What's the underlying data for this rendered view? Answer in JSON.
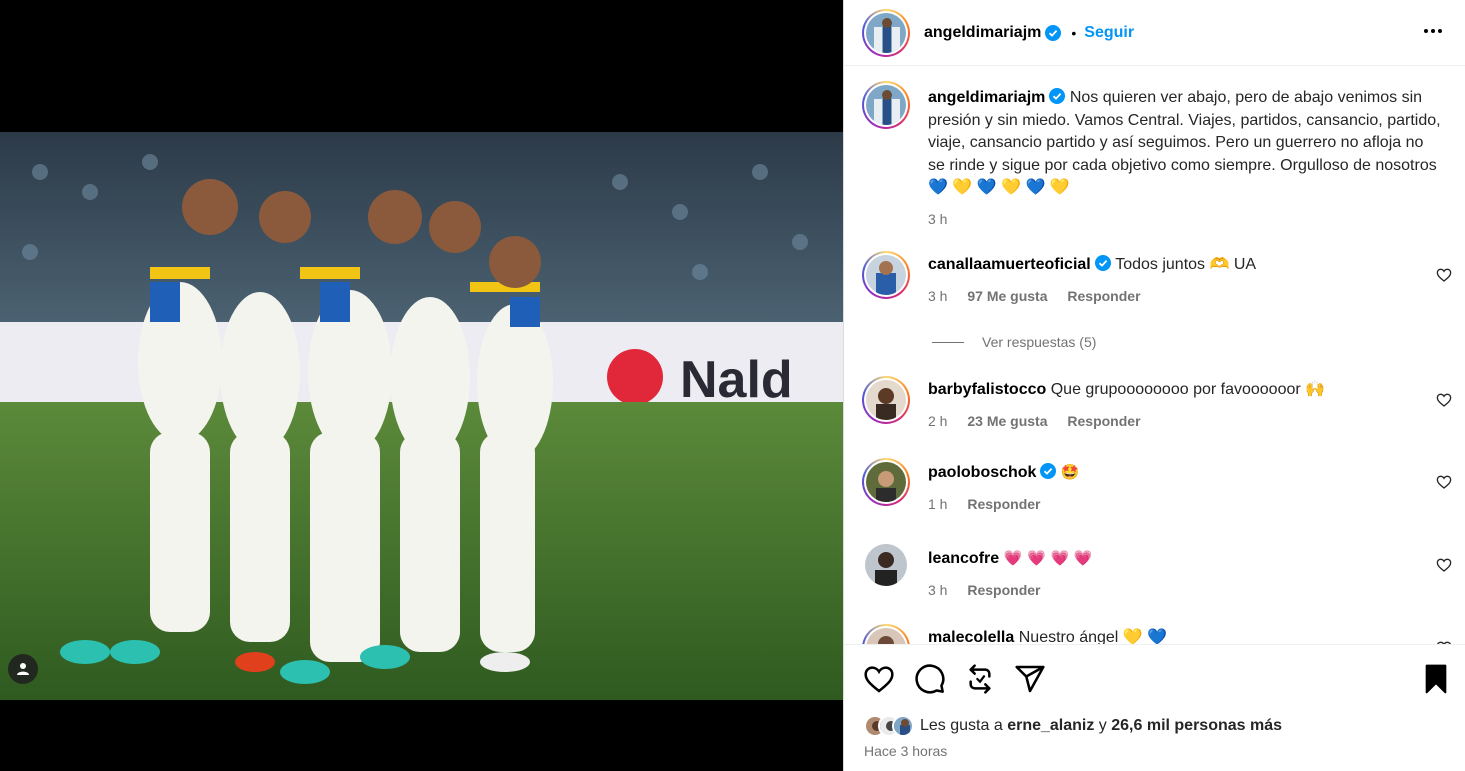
{
  "post": {
    "author": "angeldimariajm",
    "follow_label": "Seguir",
    "separator": "•"
  },
  "caption": {
    "username": "angeldimariajm",
    "text": "Nos quieren ver abajo, pero de abajo venimos sin presión y sin miedo. Vamos Central. Viajes, partidos, cansancio, partido, viaje, cansancio partido y así seguimos. Pero un guerrero no afloja no se rinde y sigue por cada objetivo como siempre. Orgulloso de nosotros 💙 💛 💙 💛 💙 💛",
    "time": "3 h"
  },
  "comments": [
    {
      "username": "canallaamuerteoficial",
      "verified": true,
      "text": "Todos juntos 🫶 UA",
      "time": "3 h",
      "likes": "97 Me gusta",
      "reply": "Responder"
    },
    {
      "username": "barbyfalistocco",
      "verified": false,
      "text": "Que grupoooooooo por favoooooor 🙌",
      "time": "2 h",
      "likes": "23 Me gusta",
      "reply": "Responder"
    },
    {
      "username": "paoloboschok",
      "verified": true,
      "text": "🤩",
      "time": "1 h",
      "likes": "",
      "reply": "Responder"
    },
    {
      "username": "leancofre",
      "verified": false,
      "text": "💗 💗 💗 💗",
      "time": "3 h",
      "likes": "",
      "reply": "Responder"
    },
    {
      "username": "malecolella",
      "verified": false,
      "text": "Nuestro ángel 💛 💙",
      "time": "",
      "likes": "",
      "reply": ""
    }
  ],
  "view_replies": "Ver respuestas (5)",
  "likes": {
    "prefix": "Les gusta a",
    "user": "erne_alaniz",
    "connector": "y",
    "others": "26,6 mil personas más"
  },
  "posted_ago": "Hace 3 horas",
  "icons": {
    "like": "heart-icon",
    "comment": "comment-icon",
    "share": "repost-icon",
    "send": "send-icon",
    "save": "bookmark-icon",
    "more": "more-icon",
    "tag": "user-tag-icon"
  },
  "colors": {
    "accent": "#0095f6",
    "secondary_text": "#737373",
    "verified": "#0095f6"
  }
}
